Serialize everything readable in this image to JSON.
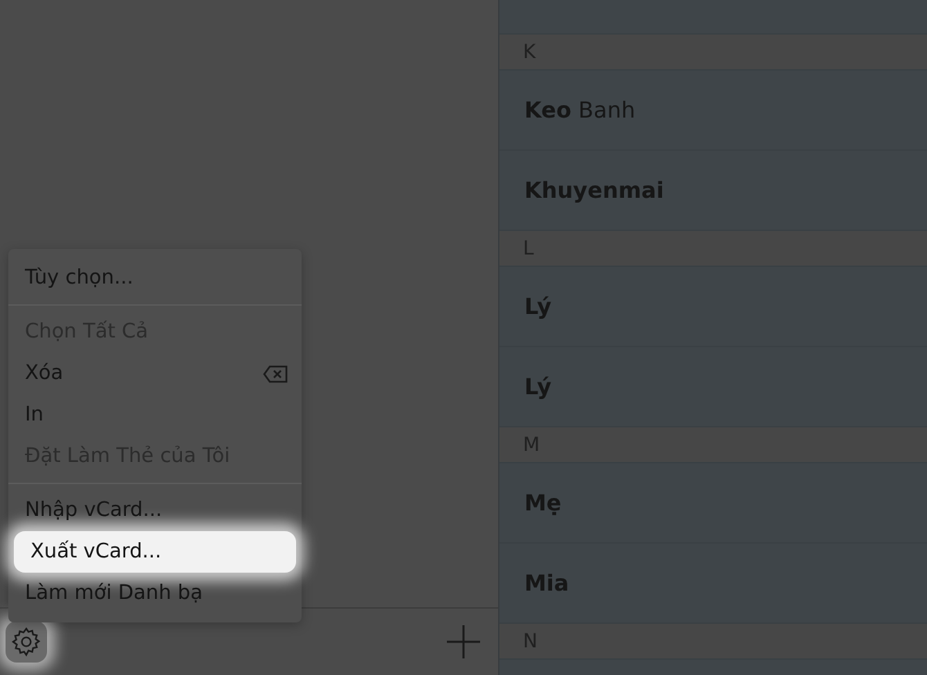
{
  "menu": {
    "items": [
      {
        "kind": "item",
        "label": "Tùy chọn...",
        "disabled": false,
        "selected": false
      },
      {
        "kind": "separator"
      },
      {
        "kind": "item",
        "label": "Chọn Tất Cả",
        "disabled": true,
        "selected": false
      },
      {
        "kind": "item",
        "label": "Xóa",
        "disabled": false,
        "selected": false,
        "delete_key": true
      },
      {
        "kind": "item",
        "label": "In",
        "disabled": false,
        "selected": false
      },
      {
        "kind": "item",
        "label": "Đặt Làm Thẻ của Tôi",
        "disabled": true,
        "selected": false
      },
      {
        "kind": "separator"
      },
      {
        "kind": "item",
        "label": "Nhập vCard...",
        "disabled": false,
        "selected": false
      },
      {
        "kind": "item",
        "label": "Xuất vCard...",
        "disabled": false,
        "selected": true
      },
      {
        "kind": "item",
        "label": "Làm mới Danh bạ",
        "disabled": false,
        "selected": false
      }
    ]
  },
  "toolbar": {
    "settings_highlighted": true
  },
  "contacts": [
    {
      "kind": "partial"
    },
    {
      "kind": "header",
      "letter": "K"
    },
    {
      "kind": "contact",
      "first": "Keo",
      "last": "Banh"
    },
    {
      "kind": "contact",
      "first": "Khuyenmai"
    },
    {
      "kind": "header",
      "letter": "L"
    },
    {
      "kind": "contact",
      "first": "Lý"
    },
    {
      "kind": "contact",
      "first": "Lý"
    },
    {
      "kind": "header",
      "letter": "M"
    },
    {
      "kind": "contact",
      "first": "Mẹ"
    },
    {
      "kind": "contact",
      "first": "Mia"
    },
    {
      "kind": "header",
      "letter": "N"
    },
    {
      "kind": "partial"
    }
  ]
}
